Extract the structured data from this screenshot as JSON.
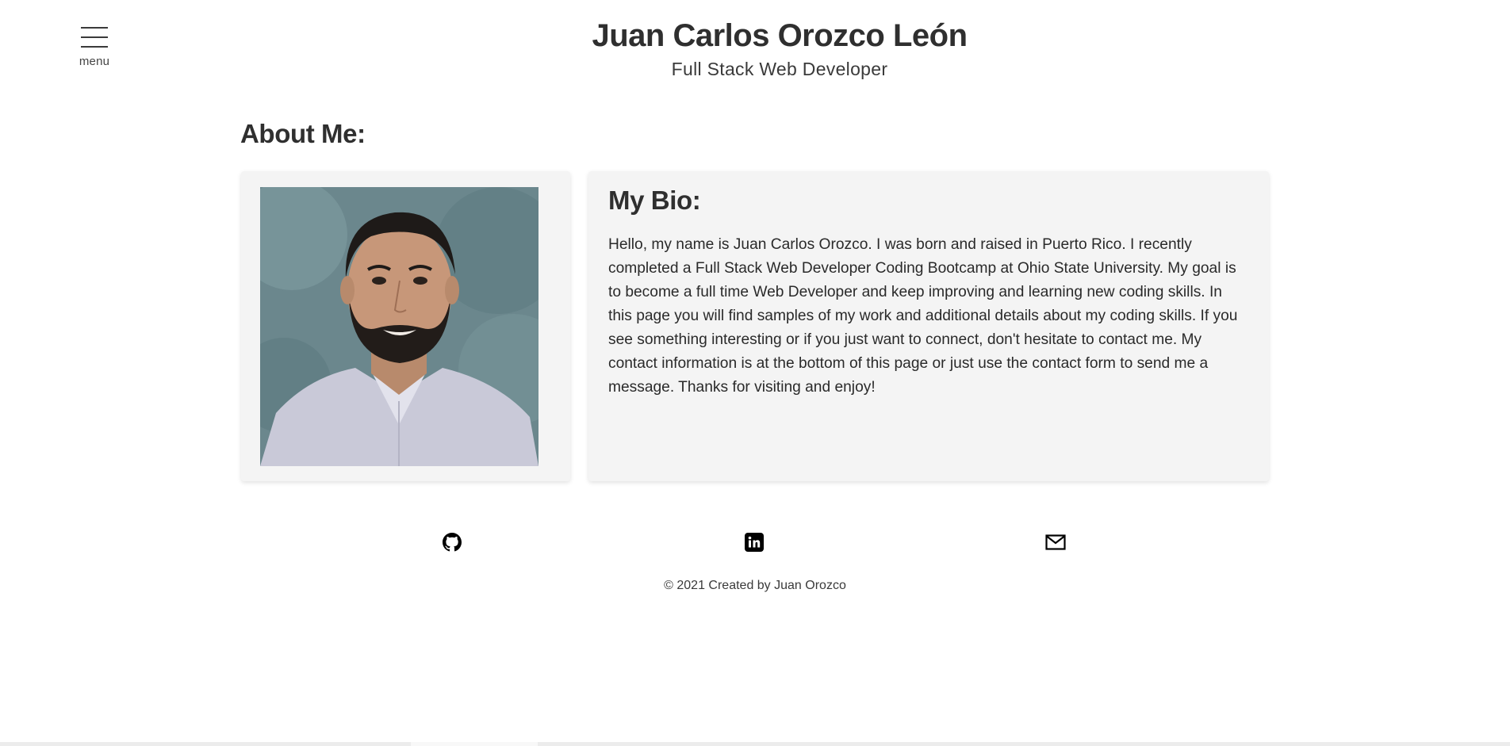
{
  "nav": {
    "menu_label": "menu"
  },
  "header": {
    "name": "Juan Carlos Orozco León",
    "role": "Full Stack Web Developer"
  },
  "about": {
    "title": "About Me:",
    "photo_alt": "Portrait photo of Juan Carlos Orozco",
    "bio_title": "My Bio:",
    "bio_text": "Hello, my name is Juan Carlos Orozco. I was born and raised in Puerto Rico. I recently completed a Full Stack Web Developer Coding Bootcamp at Ohio State University. My goal is to become a full time Web Developer and keep improving and learning new coding skills. In this page you will find samples of my work and additional details about my coding skills. If you see something interesting or if you just want to connect, don't hesitate to contact me. My contact information is at the bottom of this page or just use the contact form to send me a message. Thanks for visiting and enjoy!"
  },
  "footer": {
    "links": [
      {
        "icon": "github-icon"
      },
      {
        "icon": "linkedin-icon"
      },
      {
        "icon": "email-icon"
      }
    ],
    "copyright": "© 2021 Created by Juan Orozco"
  },
  "colors": {
    "text": "#2e2e2e",
    "card_bg": "#f4f4f4",
    "page_bg": "#ffffff"
  }
}
